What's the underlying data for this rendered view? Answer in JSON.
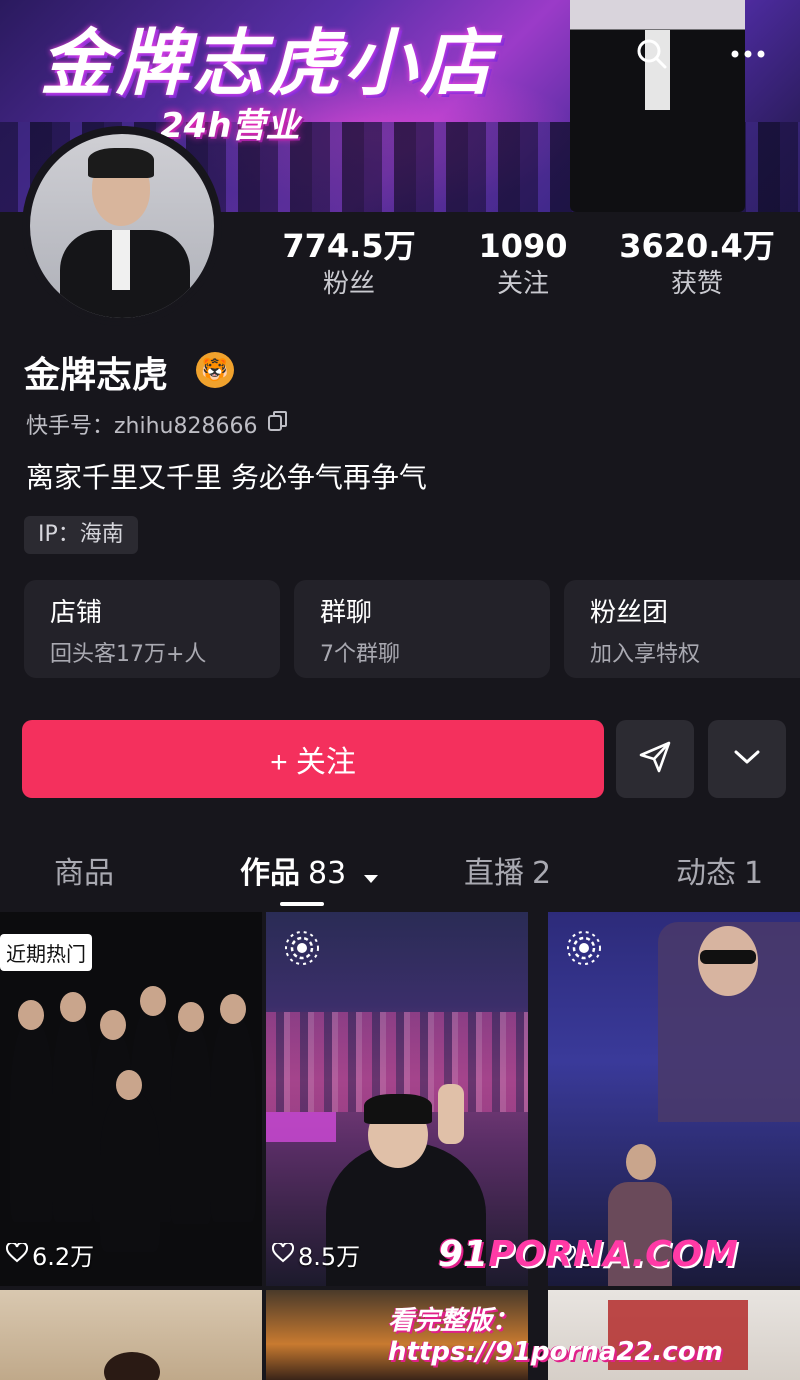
{
  "banner": {
    "title": "金牌志虎小店",
    "subtitle": "24h营业"
  },
  "header": {
    "search_icon": "search-icon",
    "more_icon": "more-icon"
  },
  "stats": [
    {
      "value": "774.5万",
      "label": "粉丝"
    },
    {
      "value": "1090",
      "label": "关注"
    },
    {
      "value": "3620.4万",
      "label": "获赞"
    }
  ],
  "profile": {
    "name": "金牌志虎",
    "emoji": "🐯",
    "uid": "快手号：zhihu828666",
    "bio": "离家千里又千里 务必争气再争气",
    "ip": "IP：海南"
  },
  "cards": [
    {
      "title": "店铺",
      "subtitle": "回头客17万+人"
    },
    {
      "title": "群聊",
      "subtitle": "7个群聊"
    },
    {
      "title": "粉丝团",
      "subtitle": "加入享特权"
    }
  ],
  "actions": {
    "follow_label": "+ 关注"
  },
  "tabs": [
    {
      "label": "商品",
      "count": ""
    },
    {
      "label": "作品",
      "count": "83"
    },
    {
      "label": "直播",
      "count": "2"
    },
    {
      "label": "动态",
      "count": "1"
    }
  ],
  "videos": [
    {
      "badge": "近期热门",
      "likes": "6.2万"
    },
    {
      "badge": "",
      "likes": "8.5万"
    },
    {
      "badge": "",
      "likes": "5."
    }
  ],
  "watermark": {
    "line1_a": "91",
    "line1_b": "PORNA.COM",
    "line2": "看完整版：https://91porna22.com"
  },
  "colors": {
    "accent": "#f4305d",
    "background": "#17161c",
    "card": "#232229"
  }
}
